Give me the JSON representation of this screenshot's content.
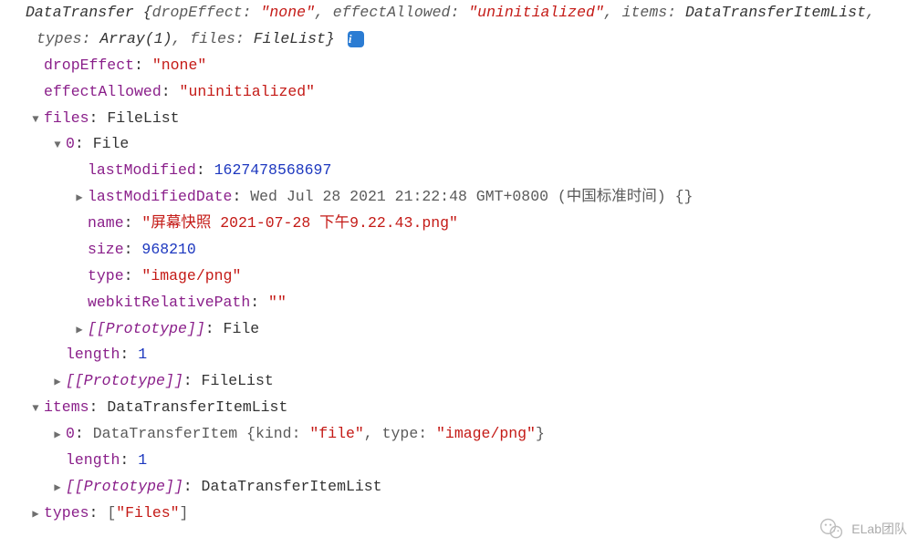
{
  "header": {
    "object_name": "DataTransfer",
    "summary_parts": [
      {
        "key": "dropEffect",
        "val": "\"none\"",
        "type": "str"
      },
      {
        "key": "effectAllowed",
        "val": "\"uninitialized\"",
        "type": "str"
      },
      {
        "key": "items",
        "val": "DataTransferItemList",
        "type": "obj",
        "cut": "Da"
      },
      {
        "key": "types",
        "val": "Array(1)",
        "type": "obj"
      },
      {
        "key": "files",
        "val": "FileList",
        "type": "obj"
      }
    ]
  },
  "rows": [
    {
      "indent": 1,
      "arrow": "",
      "key": "dropEffect",
      "keyClass": "key",
      "val": "\"none\"",
      "valClass": "val-string"
    },
    {
      "indent": 1,
      "arrow": "",
      "key": "effectAllowed",
      "keyClass": "key",
      "val": "\"uninitialized\"",
      "valClass": "val-string"
    },
    {
      "indent": 1,
      "arrow": "down",
      "key": "files",
      "keyClass": "key",
      "val": "FileList",
      "valClass": "val-object"
    },
    {
      "indent": 2,
      "arrow": "down",
      "key": "0",
      "keyClass": "key",
      "val": "File",
      "valClass": "val-object"
    },
    {
      "indent": 3,
      "arrow": "",
      "key": "lastModified",
      "keyClass": "key",
      "val": "1627478568697",
      "valClass": "val-number"
    },
    {
      "indent": 3,
      "arrow": "right",
      "key": "lastModifiedDate",
      "keyClass": "key",
      "val": "Wed Jul 28 2021 21:22:48 GMT+0800 (中国标准时间) {}",
      "valClass": "val-gray"
    },
    {
      "indent": 3,
      "arrow": "",
      "key": "name",
      "keyClass": "key",
      "val": "\"屏幕快照 2021-07-28 下午9.22.43.png\"",
      "valClass": "val-string"
    },
    {
      "indent": 3,
      "arrow": "",
      "key": "size",
      "keyClass": "key",
      "val": "968210",
      "valClass": "val-number"
    },
    {
      "indent": 3,
      "arrow": "",
      "key": "type",
      "keyClass": "key",
      "val": "\"image/png\"",
      "valClass": "val-string"
    },
    {
      "indent": 3,
      "arrow": "",
      "key": "webkitRelativePath",
      "keyClass": "key",
      "val": "\"\"",
      "valClass": "val-string"
    },
    {
      "indent": 3,
      "arrow": "right",
      "key": "[[Prototype]]",
      "keyClass": "key-internal",
      "val": "File",
      "valClass": "val-object"
    },
    {
      "indent": 2,
      "arrow": "",
      "key": "length",
      "keyClass": "key",
      "val": "1",
      "valClass": "val-number"
    },
    {
      "indent": 2,
      "arrow": "right",
      "key": "[[Prototype]]",
      "keyClass": "key-internal",
      "val": "FileList",
      "valClass": "val-object"
    },
    {
      "indent": 1,
      "arrow": "down",
      "key": "items",
      "keyClass": "key",
      "val": "DataTransferItemList",
      "valClass": "val-object"
    },
    {
      "indent": 2,
      "arrow": "right",
      "key": "0",
      "keyClass": "key",
      "compositeVal": [
        {
          "text": "DataTransferItem {",
          "cls": "val-gray"
        },
        {
          "text": "kind",
          "cls": "val-gray"
        },
        {
          "text": ": ",
          "cls": "val-gray"
        },
        {
          "text": "\"file\"",
          "cls": "val-string"
        },
        {
          "text": ", ",
          "cls": "val-gray"
        },
        {
          "text": "type",
          "cls": "val-gray"
        },
        {
          "text": ": ",
          "cls": "val-gray"
        },
        {
          "text": "\"image/png\"",
          "cls": "val-string"
        },
        {
          "text": "}",
          "cls": "val-gray"
        }
      ]
    },
    {
      "indent": 2,
      "arrow": "",
      "key": "length",
      "keyClass": "key",
      "val": "1",
      "valClass": "val-number"
    },
    {
      "indent": 2,
      "arrow": "right",
      "key": "[[Prototype]]",
      "keyClass": "key-internal",
      "val": "DataTransferItemList",
      "valClass": "val-object"
    },
    {
      "indent": 1,
      "arrow": "right",
      "key": "types",
      "keyClass": "key",
      "compositeVal": [
        {
          "text": "[",
          "cls": "val-gray"
        },
        {
          "text": "\"Files\"",
          "cls": "val-string"
        },
        {
          "text": "]",
          "cls": "val-gray"
        }
      ]
    }
  ],
  "watermark": {
    "label": "ELab团队"
  }
}
